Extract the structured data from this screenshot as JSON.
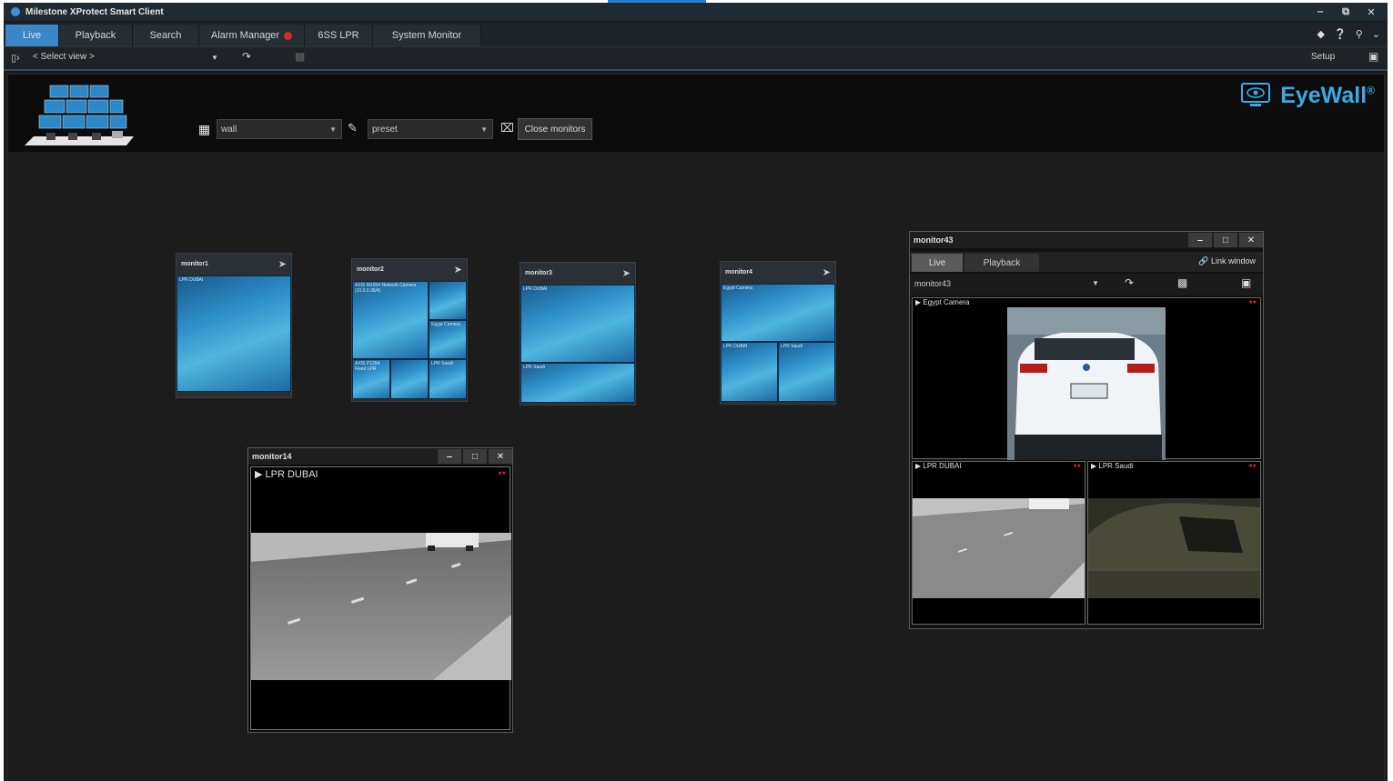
{
  "app": {
    "title": "Milestone XProtect Smart Client"
  },
  "window_controls": {
    "minimize": "‒",
    "restore": "⧉",
    "close": "✕"
  },
  "tabs": [
    {
      "label": "Live",
      "active": true
    },
    {
      "label": "Playback"
    },
    {
      "label": "Search"
    },
    {
      "label": "Alarm Manager"
    },
    {
      "label": "6SS LPR"
    },
    {
      "label": "System Monitor"
    }
  ],
  "toolbar": {
    "select_view": "< Select view >",
    "setup": "Setup"
  },
  "eyewall": {
    "brand": "EyeWall",
    "reg": "®",
    "wall_value": "wall",
    "preset_value": "preset",
    "close_monitors": "Close monitors"
  },
  "monitors": [
    {
      "name": "monitor1",
      "cams": [
        "LPR DUBAI"
      ]
    },
    {
      "name": "monitor2",
      "cams": [
        "AXIS M1054 Network Camera (10.0.0.36/4)",
        "",
        "Egypt Camera",
        "AXIS P1354 Fixed LPR",
        "",
        "LPR Saudi"
      ]
    },
    {
      "name": "monitor3",
      "cams": [
        "LPR DUBAI",
        "LPR Saudi"
      ]
    },
    {
      "name": "monitor4",
      "cams": [
        "Egypt Camera",
        "LPR DUBAI",
        "LPR Saudi"
      ]
    }
  ],
  "monitor14": {
    "title": "monitor14",
    "camera": "LPR DUBAI"
  },
  "monitor43": {
    "title": "monitor43",
    "tab_live": "Live",
    "tab_playback": "Playback",
    "link_window": "Link window",
    "view_select": "monitor43",
    "cam_top": "Egypt Camera",
    "cam_bl": "LPR DUBAI",
    "cam_br": "LPR Saudi"
  },
  "colors": {
    "accent": "#3b86c7",
    "brand": "#3da9e6",
    "alarm": "#d02b2b",
    "background": "#1c1c1c"
  }
}
